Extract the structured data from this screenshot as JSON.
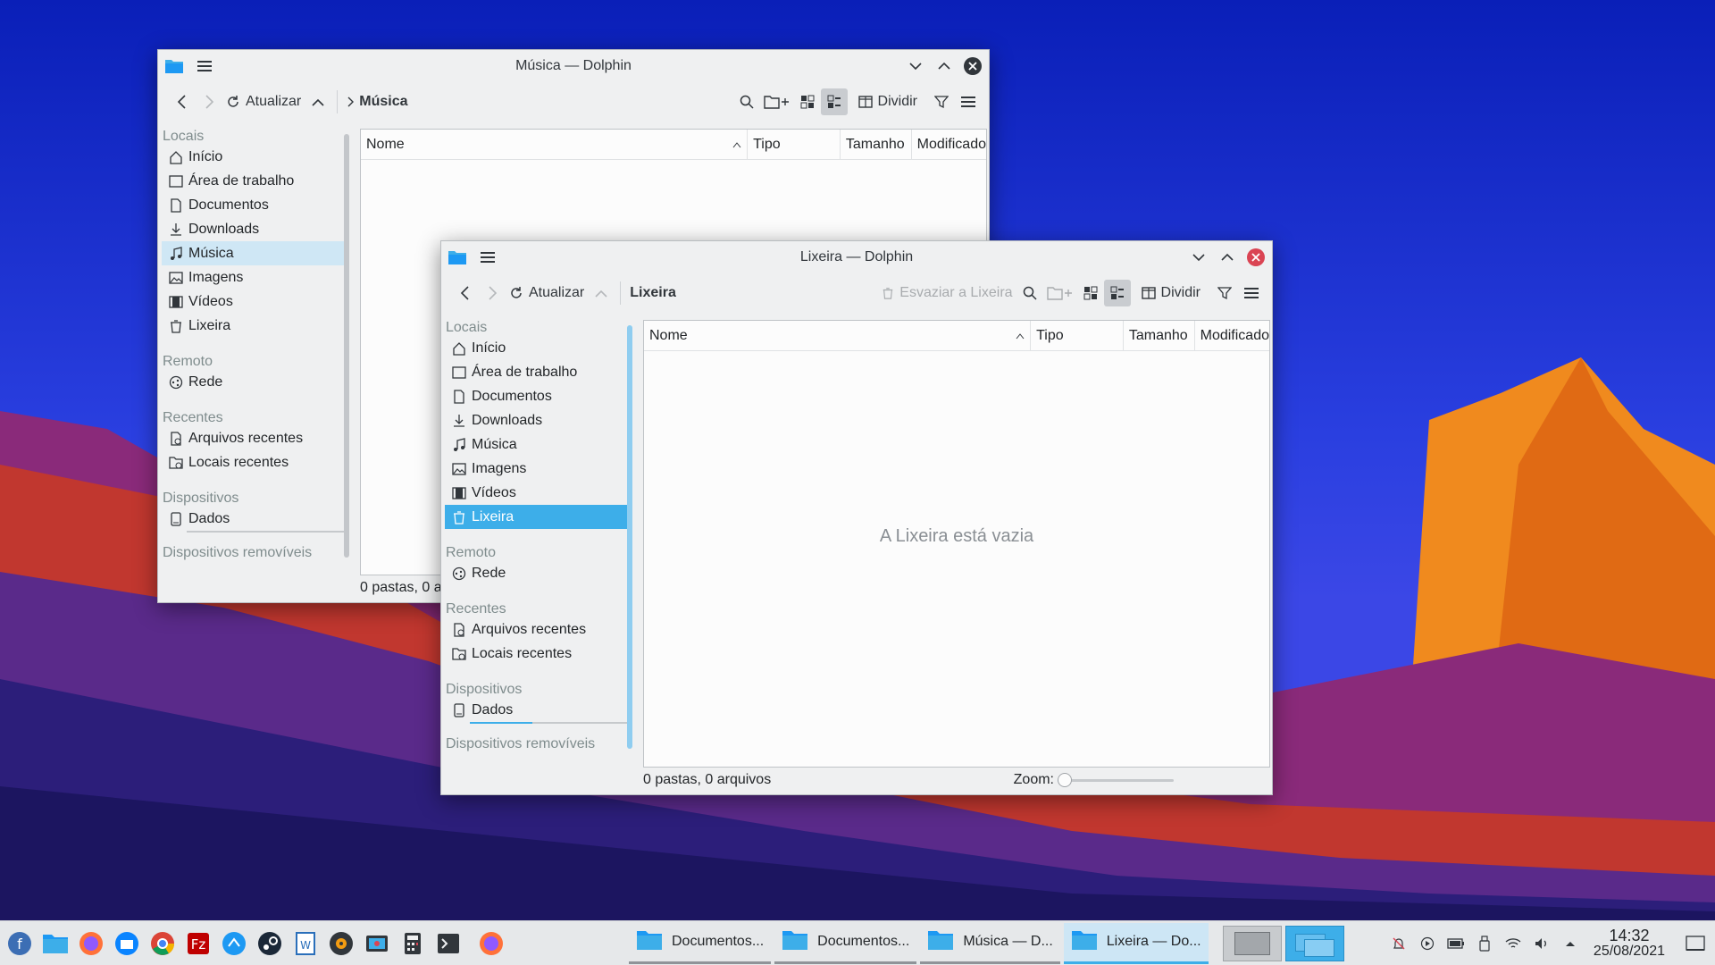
{
  "colors": {
    "accent": "#3daee9",
    "window_bg": "#eff0f1",
    "close_red": "#da4453"
  },
  "back_window": {
    "title": "Música — Dolphin",
    "toolbar": {
      "refresh_label": "Atualizar",
      "breadcrumb": "Música",
      "split_label": "Dividir"
    },
    "sidebar": {
      "places_header": "Locais",
      "places": [
        "Início",
        "Área de trabalho",
        "Documentos",
        "Downloads",
        "Música",
        "Imagens",
        "Vídeos",
        "Lixeira"
      ],
      "remote_header": "Remoto",
      "remote": [
        "Rede"
      ],
      "recent_header": "Recentes",
      "recent": [
        "Arquivos recentes",
        "Locais recentes"
      ],
      "devices_header": "Dispositivos",
      "devices": [
        "Dados"
      ],
      "removable_header": "Dispositivos removíveis"
    },
    "columns": [
      "Nome",
      "Tipo",
      "Tamanho",
      "Modificado"
    ],
    "status": "0 pastas, 0 a"
  },
  "front_window": {
    "title": "Lixeira — Dolphin",
    "toolbar": {
      "refresh_label": "Atualizar",
      "breadcrumb": "Lixeira",
      "empty_trash_label": "Esvaziar a Lixeira",
      "split_label": "Dividir"
    },
    "sidebar": {
      "places_header": "Locais",
      "places": [
        "Início",
        "Área de trabalho",
        "Documentos",
        "Downloads",
        "Música",
        "Imagens",
        "Vídeos",
        "Lixeira"
      ],
      "remote_header": "Remoto",
      "remote": [
        "Rede"
      ],
      "recent_header": "Recentes",
      "recent": [
        "Arquivos recentes",
        "Locais recentes"
      ],
      "devices_header": "Dispositivos",
      "devices": [
        "Dados"
      ],
      "removable_header": "Dispositivos removíveis"
    },
    "columns": [
      "Nome",
      "Tipo",
      "Tamanho",
      "Modificado"
    ],
    "empty_message": "A Lixeira está vazia",
    "status": "0 pastas, 0 arquivos",
    "zoom_label": "Zoom:",
    "zoom_level": 0.0
  },
  "taskbar": {
    "launchers": [
      "fedora-icon",
      "files-icon",
      "firefox-icon",
      "thunderbird-icon",
      "chrome-icon",
      "filezilla-icon",
      "share-icon",
      "steam-icon",
      "libreoffice-writer-icon",
      "media-player-icon",
      "screenshot-icon",
      "calculator-icon",
      "terminal-icon",
      "firefox-icon"
    ],
    "tasks": [
      "Documentos...",
      "Documentos...",
      "Música — D...",
      "Lixeira — Do..."
    ],
    "clock_time": "14:32",
    "clock_date": "25/08/2021"
  }
}
